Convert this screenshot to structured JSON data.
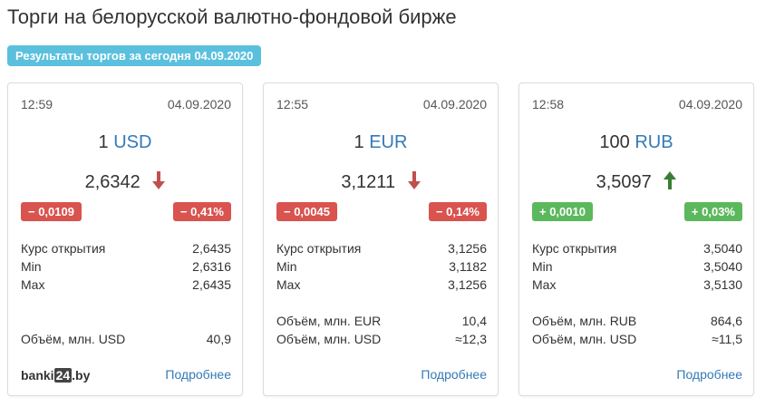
{
  "page": {
    "title": "Торги на белорусской валютно-фондовой бирже",
    "badge": "Результаты торгов за сегодня 04.09.2020"
  },
  "colors": {
    "badge_bg": "#5bc0de",
    "down": "#d9534f",
    "up": "#5cb85c",
    "arrow_down": "#c0504d",
    "arrow_up": "#3a7d35",
    "link": "#337ab7"
  },
  "cards": [
    {
      "time": "12:59",
      "date": "04.09.2020",
      "amount": "1",
      "currency": "USD",
      "rate": "2,6342",
      "direction": "down",
      "direction_icon": "arrow-down-icon",
      "change_abs": "− 0,0109",
      "change_pct": "− 0,41%",
      "open_label": "Курс открытия",
      "open_value": "2,6435",
      "min_label": "Min",
      "min_value": "2,6316",
      "max_label": "Max",
      "max_value": "2,6435",
      "volume_label": "Объём, млн. USD",
      "volume_value": "40,9",
      "logo_prefix": "banki",
      "logo_box": "24",
      "logo_suffix": ".by",
      "more_link": "Подробнее"
    },
    {
      "time": "12:55",
      "date": "04.09.2020",
      "amount": "1",
      "currency": "EUR",
      "rate": "3,1211",
      "direction": "down",
      "direction_icon": "arrow-down-icon",
      "change_abs": "− 0,0045",
      "change_pct": "− 0,14%",
      "open_label": "Курс открытия",
      "open_value": "3,1256",
      "min_label": "Min",
      "min_value": "3,1182",
      "max_label": "Max",
      "max_value": "3,1256",
      "volume_native_label": "Объём, млн. EUR",
      "volume_native_value": "10,4",
      "volume_label": "Объём, млн. USD",
      "volume_value": "≈12,3",
      "more_link": "Подробнее"
    },
    {
      "time": "12:58",
      "date": "04.09.2020",
      "amount": "100",
      "currency": "RUB",
      "rate": "3,5097",
      "direction": "up",
      "direction_icon": "arrow-up-icon",
      "change_abs": "+ 0,0010",
      "change_pct": "+ 0,03%",
      "open_label": "Курс открытия",
      "open_value": "3,5040",
      "min_label": "Min",
      "min_value": "3,5040",
      "max_label": "Max",
      "max_value": "3,5130",
      "volume_native_label": "Объём, млн. RUB",
      "volume_native_value": "864,6",
      "volume_label": "Объём, млн. USD",
      "volume_value": "≈11,5",
      "more_link": "Подробнее"
    }
  ]
}
